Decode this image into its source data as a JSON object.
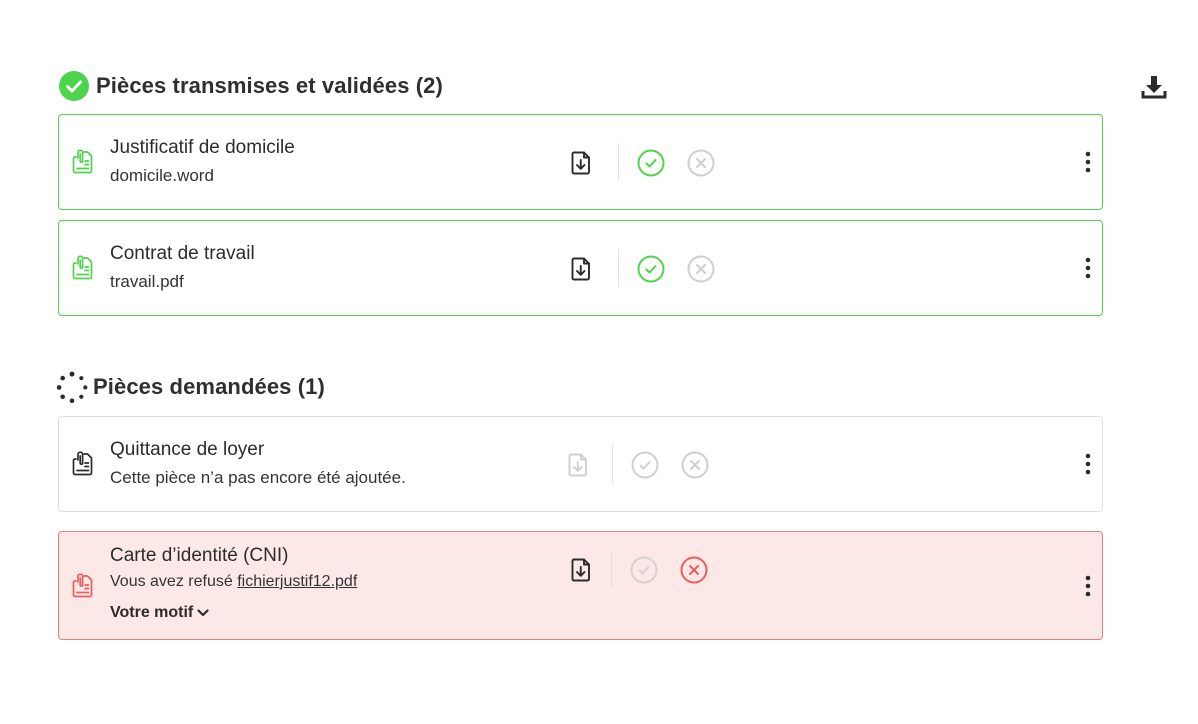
{
  "sections": {
    "validated": {
      "title": "Pièces transmises et validées (2)"
    },
    "requested": {
      "title": "Pièces demandées (1)"
    }
  },
  "items": [
    {
      "title": "Justificatif de domicile",
      "file": "domicile.word",
      "status": "validated"
    },
    {
      "title": "Contrat de travail",
      "file": "travail.pdf",
      "status": "validated"
    },
    {
      "title": "Quittance de loyer",
      "message": "Cette pièce n’a pas encore été ajoutée.",
      "status": "pending"
    },
    {
      "title": "Carte d’identité (CNI)",
      "refused_prefix": "Vous avez refusé",
      "file": "fichierjustif12.pdf",
      "motif_label": "Votre motif",
      "status": "refused"
    }
  ],
  "colors": {
    "green": "#4cd54a",
    "red": "#ee5b5b",
    "grey_icon": "#cfcfcf",
    "refused_bg": "#fde8e8"
  },
  "icons": {
    "section_validated": "check-circle-icon",
    "section_requested": "spinner-icon",
    "download_all": "download-tray-icon",
    "document": "paperclip-document-icon",
    "download_file": "file-download-icon",
    "validate": "check-circle-outline-icon",
    "refuse": "x-circle-outline-icon",
    "menu": "kebab-menu-icon"
  }
}
